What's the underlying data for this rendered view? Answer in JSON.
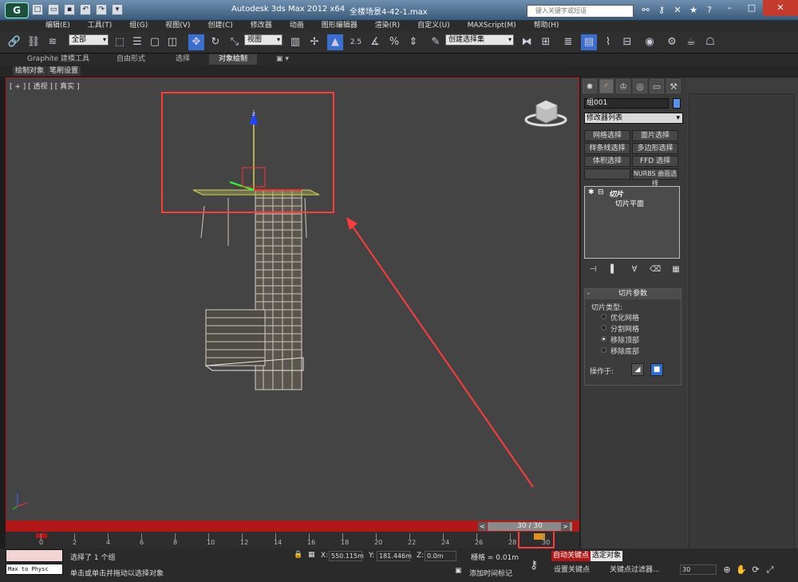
{
  "titlebar": {
    "app_title": "Autodesk 3ds Max  2012 x64",
    "file_name": "全楼场景4-42-1.max",
    "search_placeholder": "键入关键字或短语",
    "logo": "G"
  },
  "menu": [
    "编辑(E)",
    "工具(T)",
    "组(G)",
    "视图(V)",
    "创建(C)",
    "修改器",
    "动画",
    "图形编辑器",
    "渲染(R)",
    "自定义(U)",
    "MAXScript(M)",
    "帮助(H)"
  ],
  "toolbar": {
    "selection_filter": "全部",
    "ref_coord": "视图",
    "named_selection": "创建选择集",
    "angle_snap": "2.5"
  },
  "ribbon": {
    "tabs": [
      "Graphite 建模工具",
      "自由形式",
      "选择",
      "对象绘制"
    ],
    "active_tab": "对象绘制",
    "sub_tabs": [
      "绘制对象",
      "笔刷设置"
    ]
  },
  "viewport": {
    "label": "[ + ] [ 透视 ] [ 真实 ]",
    "axis_z": "z",
    "axis_x": "x",
    "axis_y": "y"
  },
  "command_panel": {
    "object_name": "组001",
    "object_color": "#5b8ee6",
    "modifier_list": "修改器列表",
    "modifier_buttons": [
      "网格选择",
      "面片选择",
      "样条线选择",
      "多边形选择",
      "体积选择",
      "FFD 选择",
      "",
      "NURBS 曲面选择"
    ],
    "stack": {
      "modifier": "切片",
      "sub": "切片平面"
    },
    "rollout": {
      "title": "切片参数",
      "slice_type_label": "切片类型:",
      "options": [
        "优化网格",
        "分割网格",
        "移除顶部",
        "移除底部"
      ],
      "selected_option": "移除顶部",
      "operate_on_label": "操作于:"
    }
  },
  "timeline": {
    "slider_text": "30 / 30",
    "ticks": [
      "0",
      "2",
      "4",
      "6",
      "8",
      "10",
      "12",
      "14",
      "16",
      "18",
      "20",
      "22",
      "24",
      "26",
      "28",
      "30"
    ]
  },
  "status": {
    "maxscript_text": "Max to Physc",
    "selection_status": "选择了 1 个组",
    "prompt": "单击或单击并拖动以选择对象",
    "x_label": "X:",
    "x_value": "550.115m",
    "y_label": "Y:",
    "y_value": "181.446m",
    "z_label": "Z:",
    "z_value": "0.0m",
    "grid": "栅格 = 0.01m",
    "add_time_tag": "添加时间标记",
    "auto_key": "自动关键点",
    "selected_objects": "选定对象",
    "set_key": "设置关键点",
    "key_filters": "关键点过滤器...",
    "current_frame": "30"
  }
}
